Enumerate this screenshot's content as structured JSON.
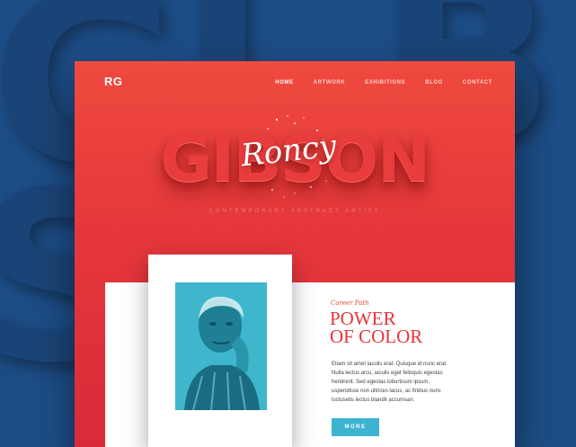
{
  "background": {
    "letters": [
      "G",
      "I",
      "B",
      "S"
    ]
  },
  "header": {
    "logo": "RG",
    "nav": [
      {
        "label": "HOME",
        "active": true
      },
      {
        "label": "ARTWORK"
      },
      {
        "label": "EXHIBITIONS"
      },
      {
        "label": "BLOG"
      },
      {
        "label": "CONTACT"
      }
    ]
  },
  "hero": {
    "title": "GIBSON",
    "script": "Roncy",
    "subtitle": "CONTEMPORARY ABSTRACT ARTIST"
  },
  "feature": {
    "eyebrow": "Career Path",
    "headline_line1": "POWER",
    "headline_line2": "OF COLOR",
    "body": "Etiam sit amet iaculis erat. Quisque id nunc erat. Nulla lectus arcu, iaculis eget felisquis egestas hendrerit. Sed egestas lobortisum ipsum, uspendisse non ultrices lacus, ac finibus nunc luctusetis lectus blandit accumsan.",
    "button": "MORE"
  },
  "colors": {
    "card_red": "#e5373b",
    "accent_blue": "#3cb4d0",
    "background_blue": "#1d4d86"
  }
}
